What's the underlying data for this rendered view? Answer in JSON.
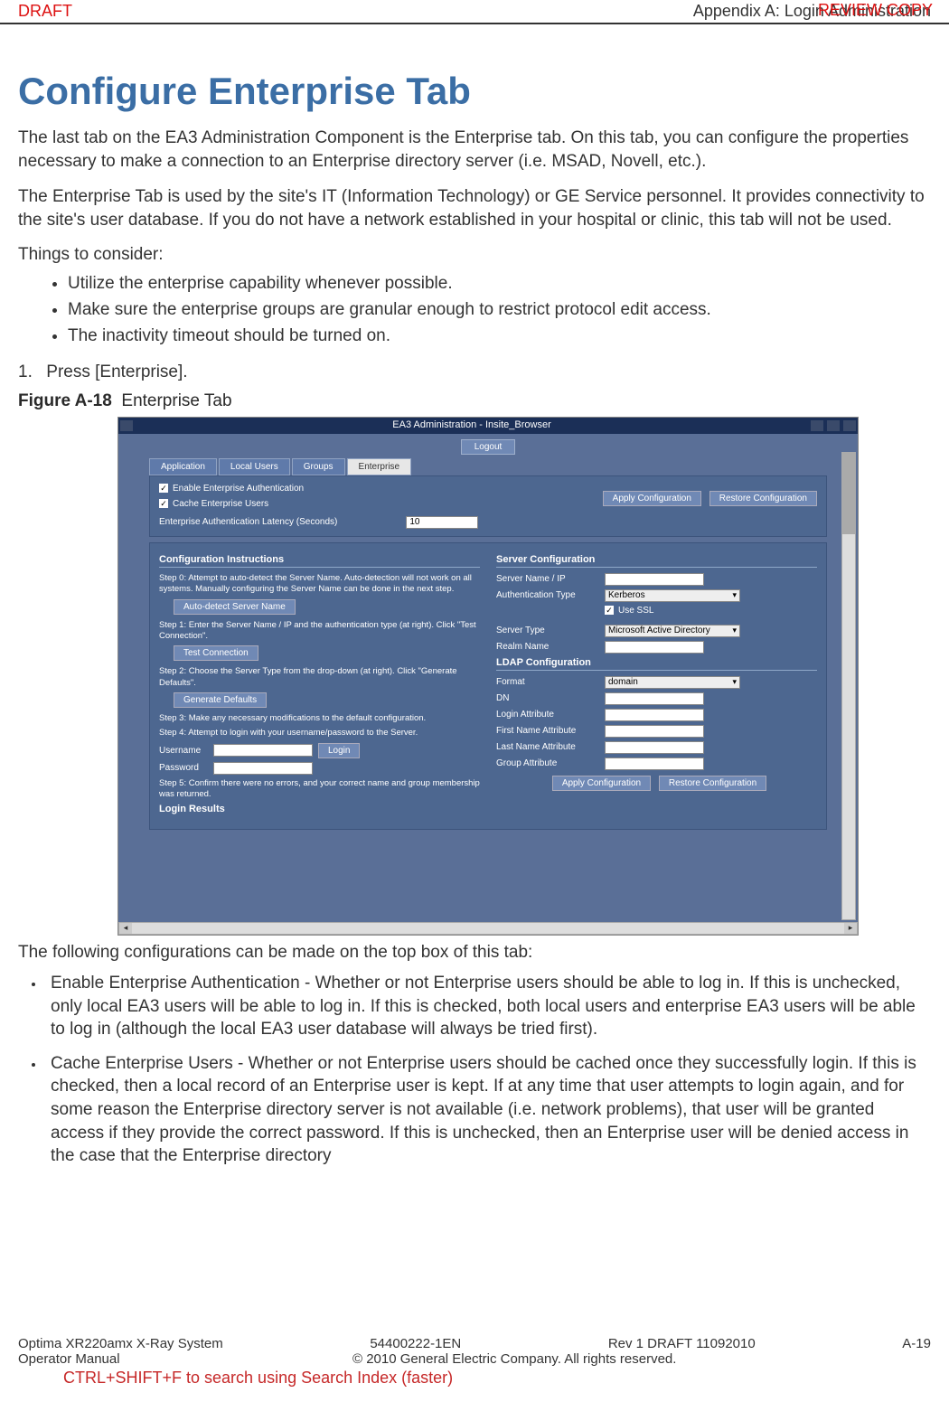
{
  "header": {
    "draft": "DRAFT",
    "review": "REVIEW COPY",
    "appendix": "Appendix A: Login Administration"
  },
  "title": "Configure Enterprise Tab",
  "para1": "The last tab on the EA3 Administration Component is the Enterprise tab. On this tab, you can configure the properties necessary to make a connection to an Enterprise directory server (i.e. MSAD, Novell, etc.).",
  "para2": "The Enterprise Tab is used by the site's IT (Information Technology) or GE Service personnel. It provides connectivity to the site's user database. If you do not have a network established in your hospital or clinic, this tab will not be used.",
  "consider_heading": "Things to consider:",
  "bullets": [
    "Utilize the enterprise capability whenever possible.",
    "Make sure the enterprise groups are granular enough to restrict protocol edit access.",
    "The inactivity timeout should be turned on."
  ],
  "step1_num": "1.",
  "step1_text": "Press [Enterprise].",
  "fig_label": "Figure A-18",
  "fig_title": "Enterprise Tab",
  "win": {
    "title": "EA3 Administration - Insite_Browser",
    "logout": "Logout",
    "tabs": {
      "t1": "Application",
      "t2": "Local Users",
      "t3": "Groups",
      "t4": "Enterprise"
    },
    "top": {
      "enable": "Enable Enterprise Authentication",
      "cache": "Cache Enterprise Users",
      "latency": "Enterprise Authentication Latency (Seconds)",
      "latency_val": "10",
      "apply": "Apply Configuration",
      "restore": "Restore Configuration"
    },
    "instr_h": "Configuration Instructions",
    "instr": {
      "s0": "Step 0: Attempt to auto-detect the Server Name. Auto-detection will not work on all systems. Manually configuring the Server Name can be done in the next step.",
      "b0": "Auto-detect Server Name",
      "s1": "Step 1: Enter the Server Name / IP and the authentication type (at right). Click \"Test Connection\".",
      "b1": "Test Connection",
      "s2": "Step 2: Choose the Server Type from the drop-down (at right). Click \"Generate Defaults\".",
      "b2": "Generate Defaults",
      "s3": "Step 3: Make any necessary modifications to the default configuration.",
      "s4": "Step 4: Attempt to login with your username/password to the Server.",
      "user": "Username",
      "pass": "Password",
      "login": "Login",
      "s5": "Step 5: Confirm there were no errors, and your correct name and group membership was returned.",
      "results": "Login Results"
    },
    "srv_h": "Server Configuration",
    "srv": {
      "name": "Server Name / IP",
      "auth": "Authentication Type",
      "auth_val": "Kerberos",
      "ssl": "Use SSL",
      "type": "Server Type",
      "type_val": "Microsoft Active Directory",
      "realm": "Realm Name"
    },
    "ldap_h": "LDAP Configuration",
    "ldap": {
      "format": "Format",
      "format_val": "domain",
      "dn": "DN",
      "loginattr": "Login Attribute",
      "fname": "First Name Attribute",
      "lname": "Last Name Attribute",
      "group": "Group Attribute",
      "apply": "Apply Configuration",
      "restore": "Restore Configuration"
    }
  },
  "after_fig": "The following configurations can be made on the top box of this tab:",
  "big_bullets": [
    "Enable Enterprise Authentication - Whether or not Enterprise users should be able to log in. If this is unchecked, only local EA3 users will be able to log in. If this is checked, both local users and enterprise EA3 users will be able to log in (although the local EA3 user database will always be tried first).",
    "Cache Enterprise Users - Whether or not Enterprise users should be cached once they successfully login. If this is checked, then a local record of an Enterprise user is kept. If at any time that user attempts to login again, and for some reason the Enterprise directory server is not available (i.e. network problems), that user will be granted access if they provide the correct password. If this is unchecked, then an Enterprise user will be denied access in the case that the Enterprise directory"
  ],
  "footer": {
    "product": "Optima XR220amx X-Ray System",
    "docnum": "54400222-1EN",
    "rev": "Rev 1 DRAFT 11092010",
    "page": "A-19",
    "manual": "Operator Manual",
    "copyright": "© 2010 General Electric Company. All rights reserved.",
    "hint": "CTRL+SHIFT+F to search using Search Index (faster)"
  }
}
